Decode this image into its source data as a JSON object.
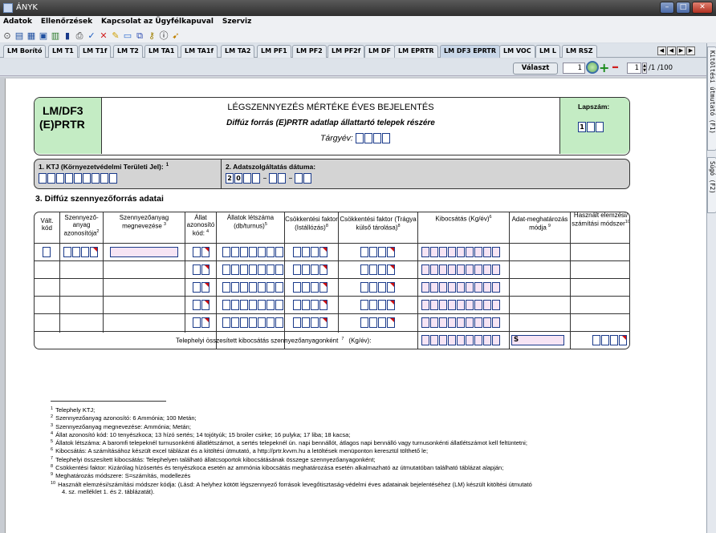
{
  "window": {
    "title": "ÁNYK",
    "buttons": {
      "minimize": "–",
      "maximize": "□",
      "close": "✕"
    }
  },
  "menu": {
    "items": [
      "Adatok",
      "Ellenőrzések",
      "Kapcsolat az Ügyfélkapuval",
      "Szerviz"
    ]
  },
  "toolbar": {
    "icons": [
      "open-icon",
      "new-icon",
      "save-icon",
      "save-as-icon",
      "print-preview-icon",
      "print-icon",
      "check-icon",
      "delete-icon",
      "highlight-icon",
      "upload-icon",
      "attach-icon",
      "key-icon",
      "info-icon",
      "cursor-icon"
    ]
  },
  "tabs": [
    {
      "label": "LM Borító"
    },
    {
      "label": "LM T1"
    },
    {
      "label": "LM T1f"
    },
    {
      "label": "LM T2"
    },
    {
      "label": "LM TA1"
    },
    {
      "label": "LM TA1f"
    },
    {
      "label": "LM TA2"
    },
    {
      "label": "LM PF1"
    },
    {
      "label": "LM PF2"
    },
    {
      "label": "LM PF2f"
    },
    {
      "label": "LM DF"
    },
    {
      "label": "LM EPRTR"
    },
    {
      "label": "LM DF3 EPRTR",
      "active": true
    },
    {
      "label": "LM VOC"
    },
    {
      "label": "LM L"
    },
    {
      "label": "LM RSZ"
    }
  ],
  "controls": {
    "valaszt_label": "Választ",
    "zoom_value": "100",
    "page_value": "1",
    "page_count": "/1 /100"
  },
  "side_tabs": [
    "Kitöltési útmutató (F1)",
    "Súgó (F2)"
  ],
  "form": {
    "code_line1": "LM/DF3",
    "code_line2": "(E)PRTR",
    "title": "LÉGSZENNYEZÉS MÉRTÉKE ÉVES BEJELENTÉS",
    "subtitle": "Diffúz forrás (E)PRTR adatlap állattartó telepek részére",
    "year_label": "Tárgyév:",
    "lapszam_label": "Lapszám:",
    "lapszam_first_digit": "1",
    "sec1_label": "1. KTJ (Környezetvédelmi Területi Jel):",
    "sec1_sup": "1",
    "sec2_label": "2. Adatszolgáltatás dátuma:",
    "date_prefix": [
      "2",
      "0"
    ],
    "date_sep": "–",
    "sec3_title": "3. Diffúz szennyezőforrás adatai",
    "columns": [
      {
        "text": "Vált. kód",
        "sup": ""
      },
      {
        "text": "Szennyező-anyag azonosítója",
        "sup": "2"
      },
      {
        "text": "Szennyezőanyag megnevezése",
        "sup": "3"
      },
      {
        "text": "Állat azonosító kód:",
        "sup": "4"
      },
      {
        "text": "Állatok létszáma (db/turnus)",
        "sup": "5"
      },
      {
        "text": "Csökkentési faktor (Istállózás)",
        "sup": "8"
      },
      {
        "text": "Csökkentési faktor (Trágya külső tárolása)",
        "sup": "8"
      },
      {
        "text": "Kibocsátás (Kg/év)",
        "sup": "6"
      },
      {
        "text": "Adat-meghatározás módja",
        "sup": "9"
      },
      {
        "text": "Használt elemzési/ számítási módszer",
        "sup": "10"
      }
    ],
    "total_label": "Telephelyi összesített kibocsátás szennyezőanyagonként",
    "total_sup": "7",
    "total_unit": "(Kg/év):",
    "method_value": "S"
  },
  "footnotes": [
    {
      "n": "1",
      "text": "Telephely KTJ;"
    },
    {
      "n": "2",
      "text": "Szennyezőanyag azonosító: 6 Ammónia; 100 Metán;"
    },
    {
      "n": "3",
      "text": "Szennyezőanyag megnevezése: Ammónia; Metán;"
    },
    {
      "n": "4",
      "text": "Állat azonosító kód: 10 tenyészkoca; 13 hízó sertés; 14 tojótyúk; 15 broiler csirke; 16 pulyka; 17 liba; 18 kacsa;"
    },
    {
      "n": "5",
      "text": "Állatok létszáma: A baromfi telepeknél turnusonkénti állatlétszámot, a sertés telepeknél ún. napi bennállót, átlagos napi bennálló vagy turnusonkénti állatlétszámot kell feltüntetni;"
    },
    {
      "n": "6",
      "text": "Kibocsátás: A számításához készült excel táblázat és a kitöltési útmutató, a http://prtr.kvvm.hu a letöltések menüponton keresztül tölthető le;"
    },
    {
      "n": "7",
      "text": "Telephelyi összesített kibocsátás: Telephelyen található állatcsoportok kibocsátásának összege szennyezőanyagonként;"
    },
    {
      "n": "8",
      "text": "Csökkentési faktor: Kizárólag hízósertés és tenyészkoca esetén az ammónia kibocsátás meghatározása esetén alkalmazható az útmutatóban található táblázat alapján;"
    },
    {
      "n": "9",
      "text": "Meghatározás módszere: S=számítás, modellezés"
    },
    {
      "n": "10",
      "text": "Használt elemzési/számítási módszer kódja: (Lásd: A helyhez kötött légszennyező források levegőtisztaság-védelmi éves adatainak bejelentéséhez (LM) készült kitöltési útmutató"
    },
    {
      "n": "",
      "text": "4. sz. melléklet 1. és 2. táblázatát)."
    }
  ]
}
